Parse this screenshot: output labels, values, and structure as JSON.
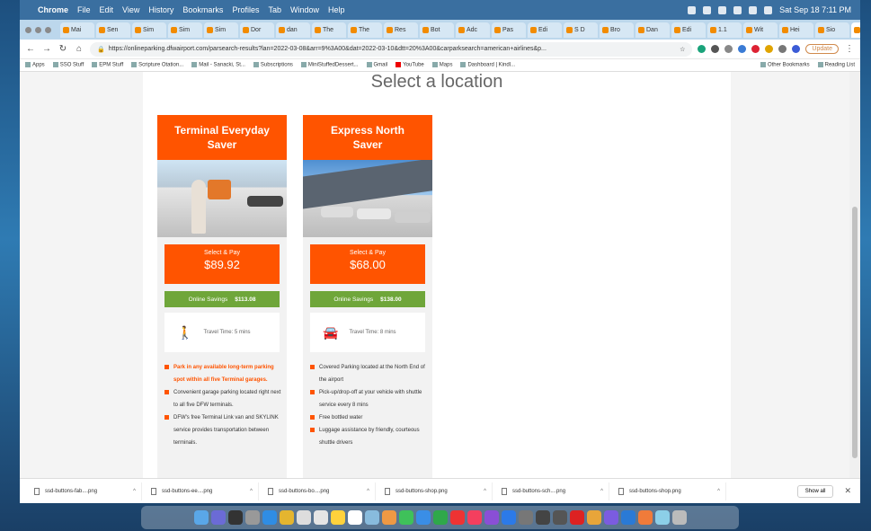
{
  "menubar": {
    "app": "Chrome",
    "items": [
      "File",
      "Edit",
      "View",
      "History",
      "Bookmarks",
      "Profiles",
      "Tab",
      "Window",
      "Help"
    ],
    "clock": "Sat Sep 18 7:11 PM"
  },
  "tabs": [
    {
      "label": "Mai"
    },
    {
      "label": "Sen"
    },
    {
      "label": "Sim"
    },
    {
      "label": "Sim"
    },
    {
      "label": "Sim"
    },
    {
      "label": "Dor"
    },
    {
      "label": "dan"
    },
    {
      "label": "The"
    },
    {
      "label": "The"
    },
    {
      "label": "Res"
    },
    {
      "label": "Bot"
    },
    {
      "label": "Adc"
    },
    {
      "label": "Pas"
    },
    {
      "label": "Edi"
    },
    {
      "label": "S D"
    },
    {
      "label": "Bro"
    },
    {
      "label": "Dan"
    },
    {
      "label": "Edi"
    },
    {
      "label": "1.1"
    },
    {
      "label": "Wit"
    },
    {
      "label": "Hei"
    },
    {
      "label": "Sio"
    },
    {
      "label": "I K",
      "active": true
    }
  ],
  "address": {
    "url": "https://onlineparking.dfwairport.com/parsearch-results?lan=2022-03-08&arr=9%3A00&dat=2022-03-10&dtt=20%3A00&carparksearch=american+airlines&p..."
  },
  "toolbar": {
    "update_label": "Update"
  },
  "bookmarks": {
    "items": [
      "Apps",
      "SSO Stuff",
      "EPM Stuff",
      "Scripture Otation...",
      "Mail - Sanacki, St...",
      "Subscriptions",
      "MiniStuffedDessert...",
      "Gmail",
      "YouTube",
      "Maps",
      "Dashboard | Kindl..."
    ],
    "right": [
      "Other Bookmarks",
      "Reading List"
    ]
  },
  "page": {
    "title": "Select a location"
  },
  "cards": [
    {
      "title": "Terminal Everyday Saver",
      "pay_label": "Select & Pay",
      "price": "$89.92",
      "savings_label": "Online Savings",
      "savings_value": "$113.08",
      "transit_text": "Travel Time: 5 mins",
      "transit_icon": "walking-person-icon",
      "features": [
        {
          "text": "Park in any available long-term parking spot within all five Terminal garages.",
          "highlight": true
        },
        {
          "text": "Convenient garage parking located right next to all five DFW terminals.",
          "highlight": false
        },
        {
          "text": "DFW's free Terminal Link van and SKYLINK service provides transportation between terminals.",
          "highlight": false
        }
      ]
    },
    {
      "title": "Express North Saver",
      "pay_label": "Select & Pay",
      "price": "$68.00",
      "savings_label": "Online Savings",
      "savings_value": "$138.00",
      "transit_text": "Travel Time: 8 mins",
      "transit_icon": "car-icon",
      "features": [
        {
          "text": "Covered Parking located at the North End of the airport",
          "highlight": false
        },
        {
          "text": "Pick-up/drop-off at your vehicle with shuttle service every 8 mins",
          "highlight": false
        },
        {
          "text": "Free bottled water",
          "highlight": false
        },
        {
          "text": "Luggage assistance by friendly, courteous shuttle drivers",
          "highlight": false
        }
      ]
    }
  ],
  "downloads": {
    "items": [
      "ssd-buttons-fab....png",
      "ssd-buttons-ee....png",
      "ssd-buttons-bo....png",
      "ssd-buttons-shop.png",
      "ssd-buttons-sch....png",
      "ssd-buttons-shop.png"
    ],
    "show_all": "Show all"
  },
  "colors": {
    "accent": "#ff5400",
    "savings": "#6fa63a"
  }
}
